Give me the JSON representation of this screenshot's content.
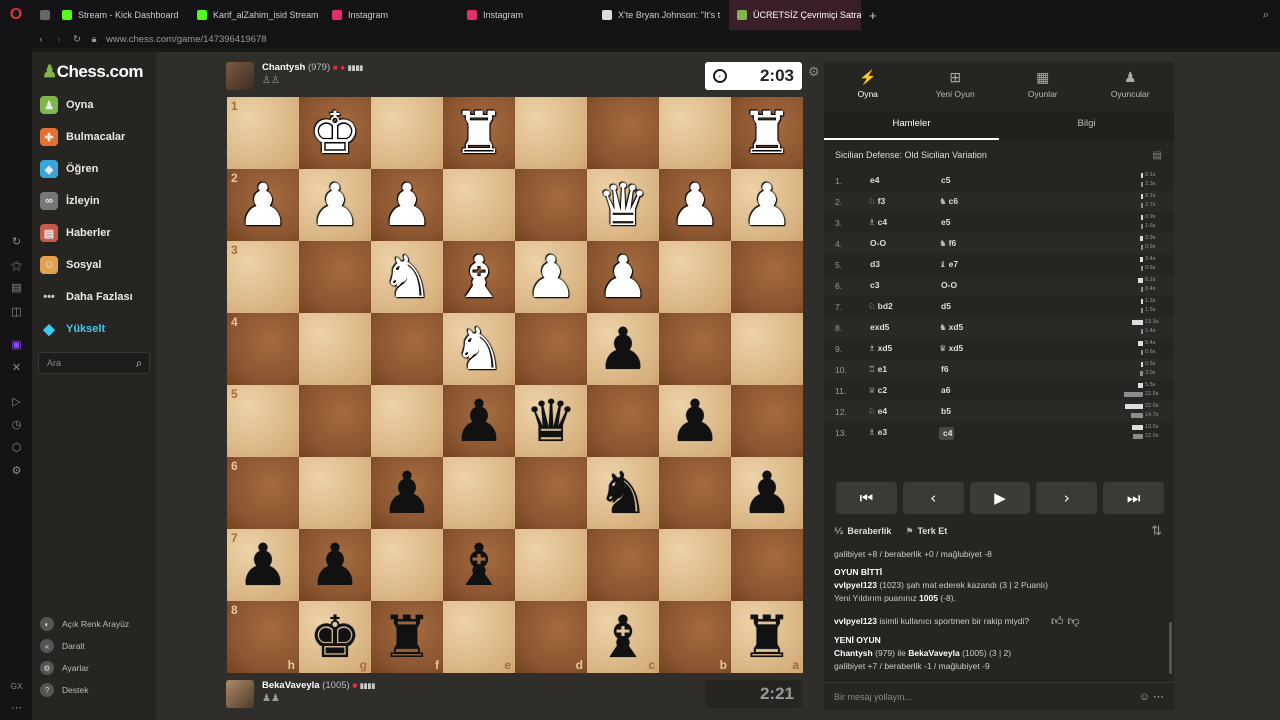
{
  "browser": {
    "tabs": [
      {
        "label": "Stream - Kick Dashboard",
        "color": "#53fc18"
      },
      {
        "label": "Karif_alZahim_isid Stream",
        "color": "#53fc18"
      },
      {
        "label": "Instagram",
        "color": "#e1306c"
      },
      {
        "label": "Instagram",
        "color": "#e1306c"
      },
      {
        "label": "X'te Bryan Johnson: \"It's t",
        "color": "#dddddd"
      },
      {
        "label": "ÜCRETSİZ Çevrimiçi Satran",
        "color": "#81b64c"
      }
    ],
    "url": "www.chess.com/game/147396419678"
  },
  "sidebar": {
    "logo": "Chess.com",
    "items": [
      {
        "label": "Oyna",
        "icon": "play-icon",
        "color": "#81b64c"
      },
      {
        "label": "Bulmacalar",
        "icon": "puzzle-icon",
        "color": "#e37232"
      },
      {
        "label": "Öğren",
        "icon": "learn-icon",
        "color": "#3aa6d8"
      },
      {
        "label": "İzleyin",
        "icon": "watch-icon",
        "color": "#cfcfcf"
      },
      {
        "label": "Haberler",
        "icon": "news-icon",
        "color": "#c75a4a"
      },
      {
        "label": "Sosyal",
        "icon": "social-icon",
        "color": "#e3a14d"
      },
      {
        "label": "Daha Fazlası",
        "icon": "more-icon",
        "color": "#cfcfcf"
      },
      {
        "label": "Yükselt",
        "icon": "diamond-icon",
        "color": "#3ec8f0"
      }
    ],
    "search_placeholder": "Ara",
    "bottom": [
      {
        "label": "Açık Renk Arayüz",
        "icon": "◐"
      },
      {
        "label": "Daralt",
        "icon": "«"
      },
      {
        "label": "Ayarlar",
        "icon": "⚙"
      },
      {
        "label": "Destek",
        "icon": "?"
      }
    ]
  },
  "top_player": {
    "name": "Chantysh",
    "rating": "(979)",
    "clock": "2:03",
    "captured": "♙♙"
  },
  "bottom_player": {
    "name": "BekaVaveyla",
    "rating": "(1005)",
    "clock": "2:21",
    "captured": "♟♟"
  },
  "board": {
    "ranks": [
      "1",
      "2",
      "3",
      "4",
      "5",
      "6",
      "7",
      "8"
    ],
    "files": [
      "h",
      "g",
      "f",
      "e",
      "d",
      "c",
      "b",
      "a"
    ],
    "position": [
      [
        "",
        "wK",
        "",
        "wR",
        "",
        "",
        "",
        "wR"
      ],
      [
        "wP",
        "wP",
        "wP",
        "",
        "",
        "wQ",
        "wP",
        "wP"
      ],
      [
        "",
        "",
        "wN",
        "wB",
        "wP",
        "wP",
        "",
        ""
      ],
      [
        "",
        "",
        "",
        "wN",
        "",
        "bP",
        "",
        ""
      ],
      [
        "",
        "",
        "",
        "bP",
        "bQ",
        "",
        "bP",
        ""
      ],
      [
        "",
        "",
        "bP",
        "",
        "",
        "bN",
        "",
        "bP"
      ],
      [
        "bP",
        "bP",
        "",
        "bB",
        "",
        "",
        "",
        ""
      ],
      [
        "",
        "bK",
        "bR",
        "",
        "",
        "bB",
        "",
        "bR"
      ]
    ]
  },
  "panel": {
    "topnav": [
      {
        "label": "Oyna",
        "icon": "⚡"
      },
      {
        "label": "Yeni Oyun",
        "icon": "⊞"
      },
      {
        "label": "Oyunlar",
        "icon": "▦"
      },
      {
        "label": "Oyuncular",
        "icon": "♟"
      }
    ],
    "subtabs": [
      "Hamleler",
      "Bilgi"
    ],
    "opening": "Sicilian Defense: Old Sicilian Variation",
    "moves": [
      {
        "n": "1.",
        "w": "e4",
        "wp": "",
        "b": "c5",
        "bp": "",
        "tw": "0.1s",
        "tb": "2.3s",
        "fw": 0.05,
        "fb": 0.1
      },
      {
        "n": "2.",
        "w": "f3",
        "wp": "♘",
        "b": "c6",
        "bp": "♞",
        "tw": "0.1s",
        "tb": "2.7s",
        "fw": 0.05,
        "fb": 0.12
      },
      {
        "n": "3.",
        "w": "c4",
        "wp": "♗",
        "b": "e5",
        "bp": "",
        "tw": "0.9s",
        "tb": "1.6s",
        "fw": 0.06,
        "fb": 0.08
      },
      {
        "n": "4.",
        "w": "O-O",
        "wp": "",
        "b": "f6",
        "bp": "♞",
        "tw": "2.9s",
        "tb": "0.9s",
        "fw": 0.14,
        "fb": 0.06
      },
      {
        "n": "5.",
        "w": "d3",
        "wp": "",
        "b": "e7",
        "bp": "♝",
        "tw": "3.4s",
        "tb": "0.6s",
        "fw": 0.16,
        "fb": 0.05
      },
      {
        "n": "6.",
        "w": "c3",
        "wp": "",
        "b": "O-O",
        "bp": "",
        "tw": "6.2s",
        "tb": "0.4s",
        "fw": 0.28,
        "fb": 0.04
      },
      {
        "n": "7.",
        "w": "bd2",
        "wp": "♘",
        "b": "d5",
        "bp": "",
        "tw": "1.2s",
        "tb": "1.5s",
        "fw": 0.07,
        "fb": 0.08
      },
      {
        "n": "8.",
        "w": "exd5",
        "wp": "",
        "b": "xd5",
        "bp": "♞",
        "tw": "13.3s",
        "tb": "1.4s",
        "fw": 0.6,
        "fb": 0.07
      },
      {
        "n": "9.",
        "w": "xd5",
        "wp": "♗",
        "b": "xd5",
        "bp": "♛",
        "tw": "5.4s",
        "tb": "0.6s",
        "fw": 0.25,
        "fb": 0.05
      },
      {
        "n": "10.",
        "w": "e1",
        "wp": "♖",
        "b": "f6",
        "bp": "",
        "tw": "0.5s",
        "tb": "3.0s",
        "fw": 0.05,
        "fb": 0.14
      },
      {
        "n": "11.",
        "w": "c2",
        "wp": "♕",
        "b": "a6",
        "bp": "",
        "tw": "5.5s",
        "tb": "22.6s",
        "fw": 0.25,
        "fb": 1.0
      },
      {
        "n": "12.",
        "w": "e4",
        "wp": "♘",
        "b": "b5",
        "bp": "",
        "tw": "22.0s",
        "tb": "14.7s",
        "fw": 0.97,
        "fb": 0.65
      },
      {
        "n": "13.",
        "w": "e3",
        "wp": "♗",
        "b": "c4",
        "bp": "",
        "tw": "13.0s",
        "tb": "12.0s",
        "fw": 0.58,
        "fb": 0.53
      }
    ],
    "actions": {
      "draw": "Beraberlik",
      "resign": "Terk Et"
    },
    "chat": {
      "line1": "galibiyet +8 / beraberlik +0 / mağlubiyet -8",
      "game_over": "OYUN BİTTİ",
      "result_user": "vvlpyel123",
      "result_text": "(1023) şah mat ederek kazandı (3 | 2 Puanlı)",
      "new_rating_prefix": "Yeni Yıldırım puanınız",
      "new_rating_value": "1005",
      "new_rating_suffix": "(-8).",
      "sport_user": "vvlpyel123",
      "sport_text": "isimli kullanıcı sportmen bir rakip miydi?",
      "new_game": "YENİ OYUN",
      "ng_p1": "Chantysh",
      "ng_mid": "(979) ile",
      "ng_p2": "BekaVaveyla",
      "ng_tail": "(1005) (3 | 2)",
      "line_last": "galibiyet +7 / beraberlik -1 / mağlubiyet -9",
      "placeholder": "Bir mesaj yollayın..."
    }
  }
}
